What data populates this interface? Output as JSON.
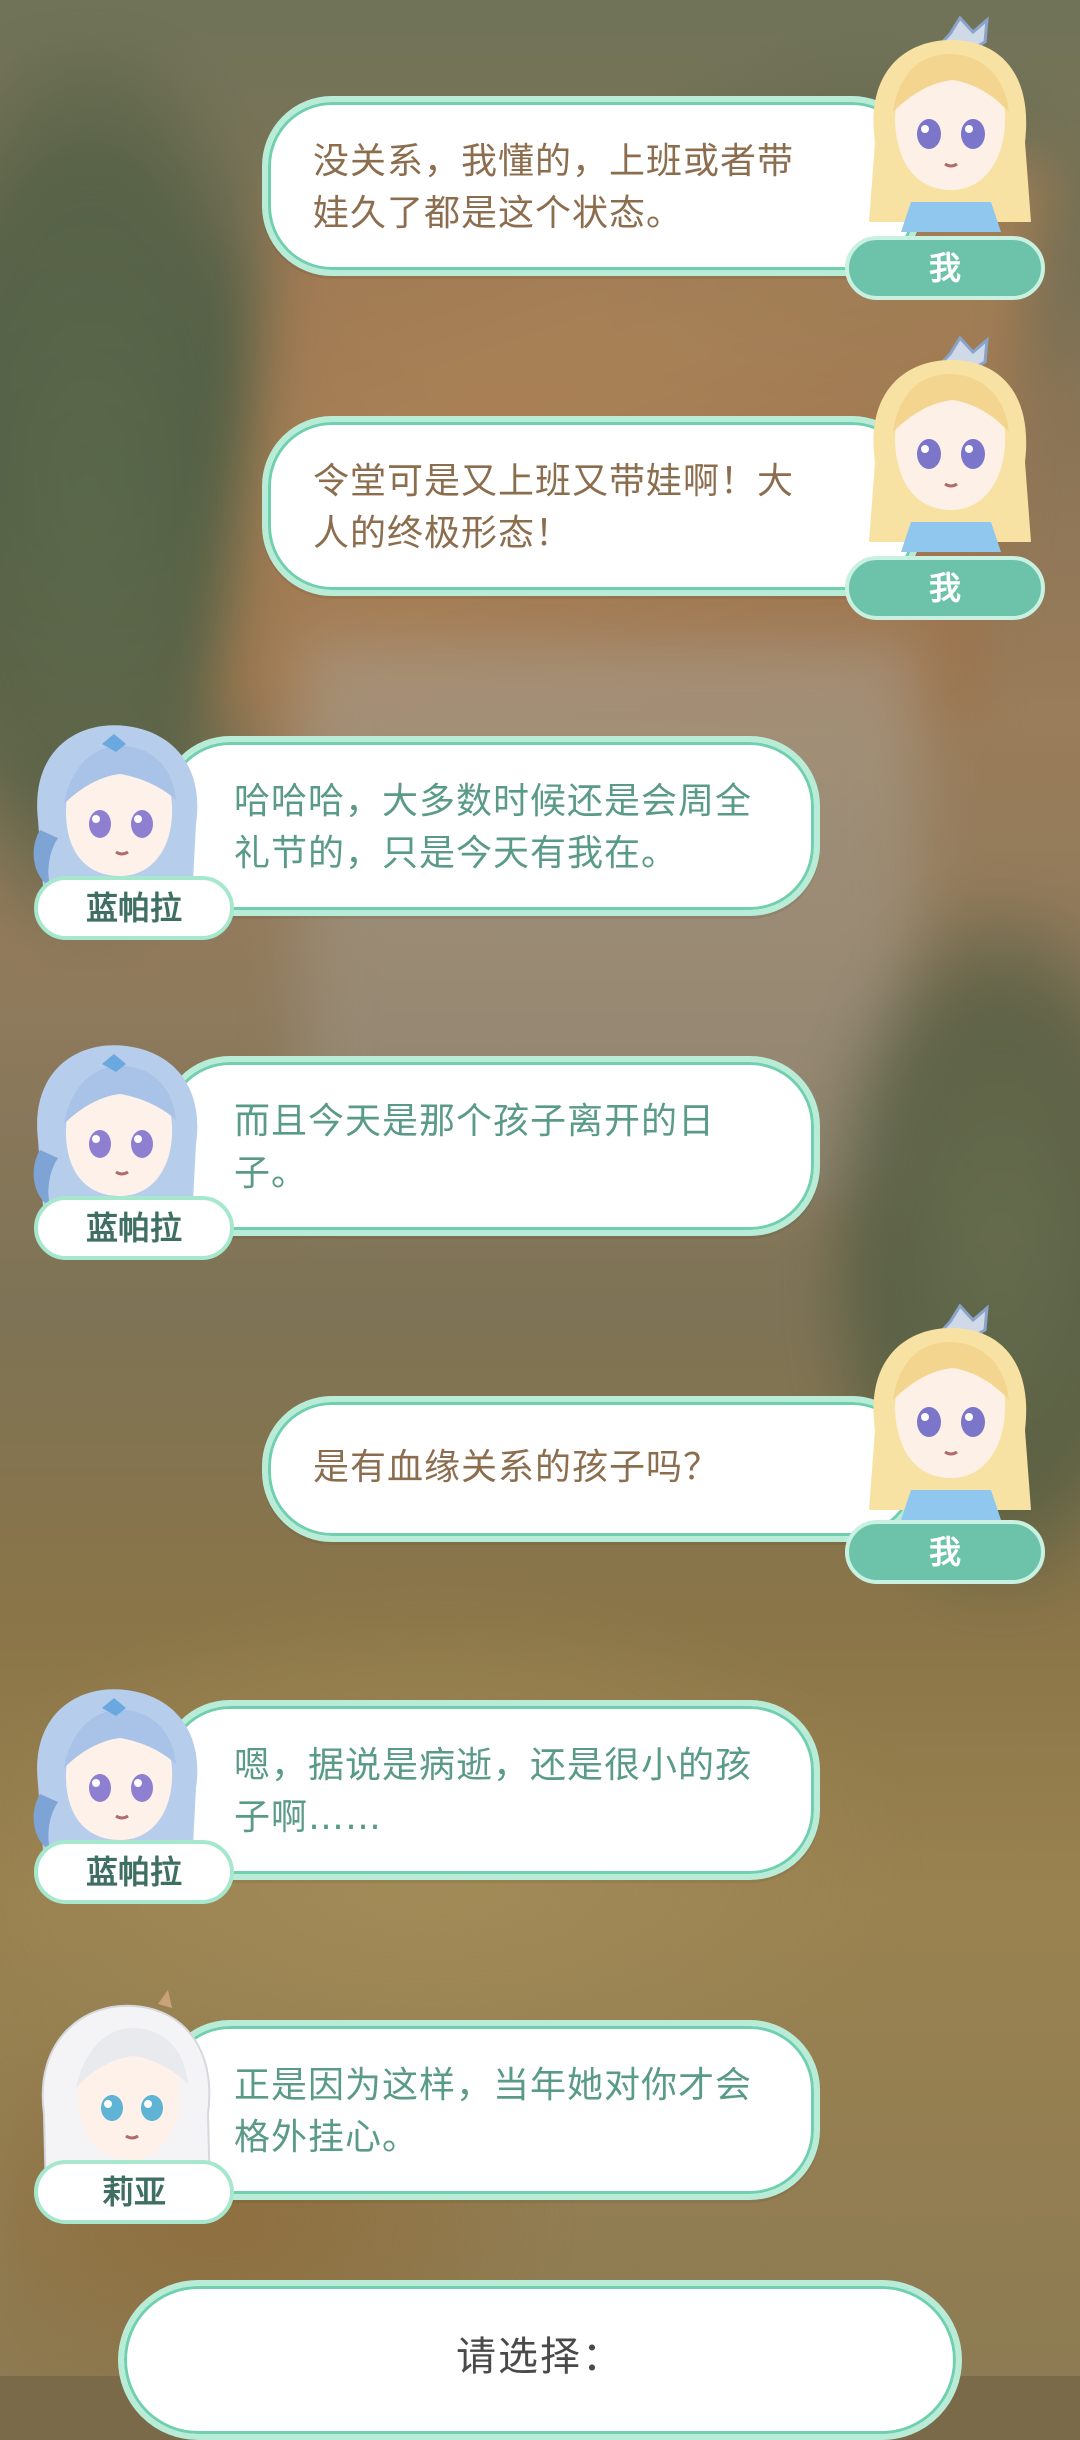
{
  "dialogue": [
    {
      "side": "me",
      "speaker": "我",
      "text": "没关系，我懂的，上班或者带娃久了都是这个状态。",
      "lines": [
        "没关系，我懂的，上班或者带",
        "娃久了都是这个状态。"
      ],
      "avatar": "blonde-girl-avatar"
    },
    {
      "side": "me",
      "speaker": "我",
      "text": "令堂可是又上班又带娃啊！大人的终极形态！",
      "lines": [
        "令堂可是又上班又带娃啊！大",
        "人的终极形态！"
      ],
      "avatar": "blonde-girl-avatar"
    },
    {
      "side": "npc",
      "speaker": "蓝帕拉",
      "text": "哈哈哈，大多数时候还是会周全礼节的，只是今天有我在。",
      "lines": [
        "哈哈哈，大多数时候还是会周全",
        "礼节的，只是今天有我在。"
      ],
      "avatar": "blue-hair-girl-avatar"
    },
    {
      "side": "npc",
      "speaker": "蓝帕拉",
      "text": "而且今天是那个孩子离开的日子。",
      "lines": [
        "而且今天是那个孩子离开的日",
        "子。"
      ],
      "avatar": "blue-hair-girl-avatar"
    },
    {
      "side": "me",
      "speaker": "我",
      "text": "是有血缘关系的孩子吗？",
      "lines": [
        "是有血缘关系的孩子吗？"
      ],
      "avatar": "blonde-girl-avatar"
    },
    {
      "side": "npc",
      "speaker": "蓝帕拉",
      "text": "嗯，据说是病逝，还是很小的孩子啊……",
      "lines": [
        "嗯，据说是病逝，还是很小的孩",
        "子啊……"
      ],
      "avatar": "blue-hair-girl-avatar"
    },
    {
      "side": "npc",
      "speaker": "莉亚",
      "text": "正是因为这样，当年她对你才会格外挂心。",
      "lines": [
        "正是因为这样，当年她对你才会",
        "格外挂心。"
      ],
      "avatar": "white-hair-girl-avatar"
    }
  ],
  "choice": {
    "prompt": "请选择："
  },
  "colors": {
    "bubble_border": "#b9ecd6",
    "bubble_border_inner": "#6fcfae",
    "me_text": "#8c6d4e",
    "npc_text": "#5a9a88",
    "me_tag_bg": "#6dc3a9",
    "npc_tag_text": "#3f6f62"
  }
}
